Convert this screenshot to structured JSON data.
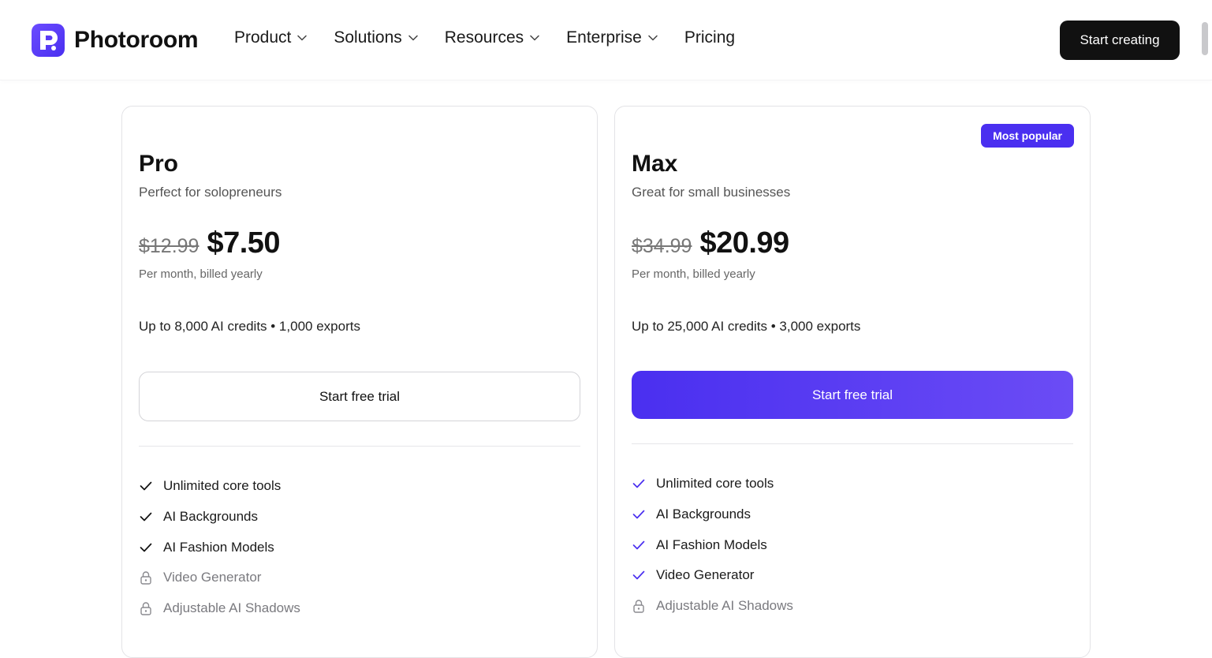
{
  "header": {
    "brand": "Photoroom",
    "nav": [
      {
        "label": "Product",
        "has_menu": true
      },
      {
        "label": "Solutions",
        "has_menu": true
      },
      {
        "label": "Resources",
        "has_menu": true
      },
      {
        "label": "Enterprise",
        "has_menu": true
      },
      {
        "label": "Pricing",
        "has_menu": false
      }
    ],
    "cta": "Start creating"
  },
  "colors": {
    "accent": "#4a2ff0",
    "text": "#111111",
    "muted": "#777777"
  },
  "plans": [
    {
      "name": "Pro",
      "subtitle": "Perfect for solopreneurs",
      "old_price": "$12.99",
      "price": "$7.50",
      "billing": "Per month, billed yearly",
      "credits": "Up to 8,000 AI credits • 1,000 exports",
      "button": "Start free trial",
      "features": [
        {
          "label": "Unlimited core tools",
          "icon": "check-icon"
        },
        {
          "label": "AI Backgrounds",
          "icon": "check-icon"
        },
        {
          "label": "AI Fashion Models",
          "icon": "check-icon"
        },
        {
          "label": "Video Generator",
          "icon": "lock-icon"
        },
        {
          "label": "Adjustable AI Shadows",
          "icon": "lock-icon"
        }
      ]
    },
    {
      "name": "Max",
      "badge": "Most popular",
      "subtitle": "Great for small businesses",
      "old_price": "$34.99",
      "price": "$20.99",
      "billing": "Per month, billed yearly",
      "credits": "Up to 25,000 AI credits • 3,000 exports",
      "button": "Start free trial",
      "features": [
        {
          "label": "Unlimited core tools",
          "icon": "check-icon"
        },
        {
          "label": "AI Backgrounds",
          "icon": "check-icon"
        },
        {
          "label": "AI Fashion Models",
          "icon": "check-icon"
        },
        {
          "label": "Video Generator",
          "icon": "check-icon"
        },
        {
          "label": "Adjustable AI Shadows",
          "icon": "lock-icon"
        }
      ]
    }
  ]
}
